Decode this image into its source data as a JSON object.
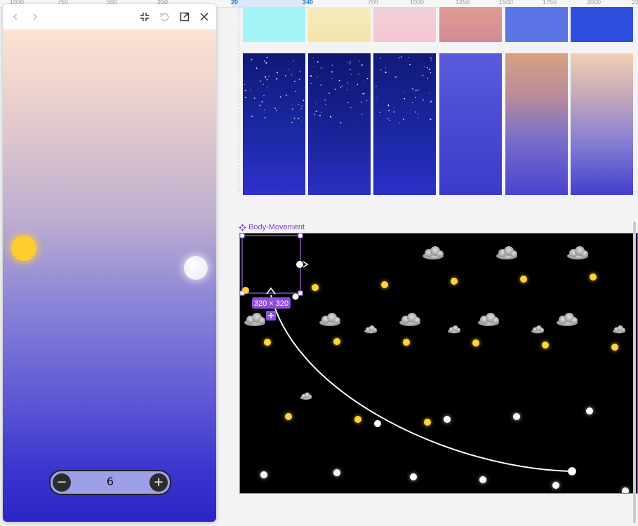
{
  "ruler": {
    "ticks": [
      "1000",
      "750",
      "500",
      "250",
      "20",
      "340",
      "700",
      "1000",
      "1250",
      "1500",
      "1750",
      "2000",
      "22"
    ]
  },
  "preview": {
    "toolbar": {
      "back": "chevron-left-icon",
      "forward": "chevron-right-icon",
      "collapse": "collapse-icon",
      "reset": "undo-icon",
      "open_external": "external-link-icon",
      "close": "close-icon"
    },
    "stepper": {
      "minus_label": "−",
      "value": "6",
      "plus_label": "+"
    },
    "sky_gradient": [
      "#fde3d2",
      "#bfaed0",
      "#8c86d7",
      "#3a34d0",
      "#2a25c8"
    ]
  },
  "gradient_frames": {
    "top_row": [
      "#a4f5f8",
      "#f6e9b0",
      "#eec6d4",
      "#da9592",
      "#5a74e6",
      "#2f4fe0"
    ],
    "bottom_row": [
      "night-stars-1",
      "night-stars-2",
      "night-stars-3",
      "dusk-blue",
      "sunset-blue",
      "dawn-blue"
    ]
  },
  "body_movement": {
    "frame_name": "Body-Movement",
    "selection_size": "320 × 320"
  }
}
